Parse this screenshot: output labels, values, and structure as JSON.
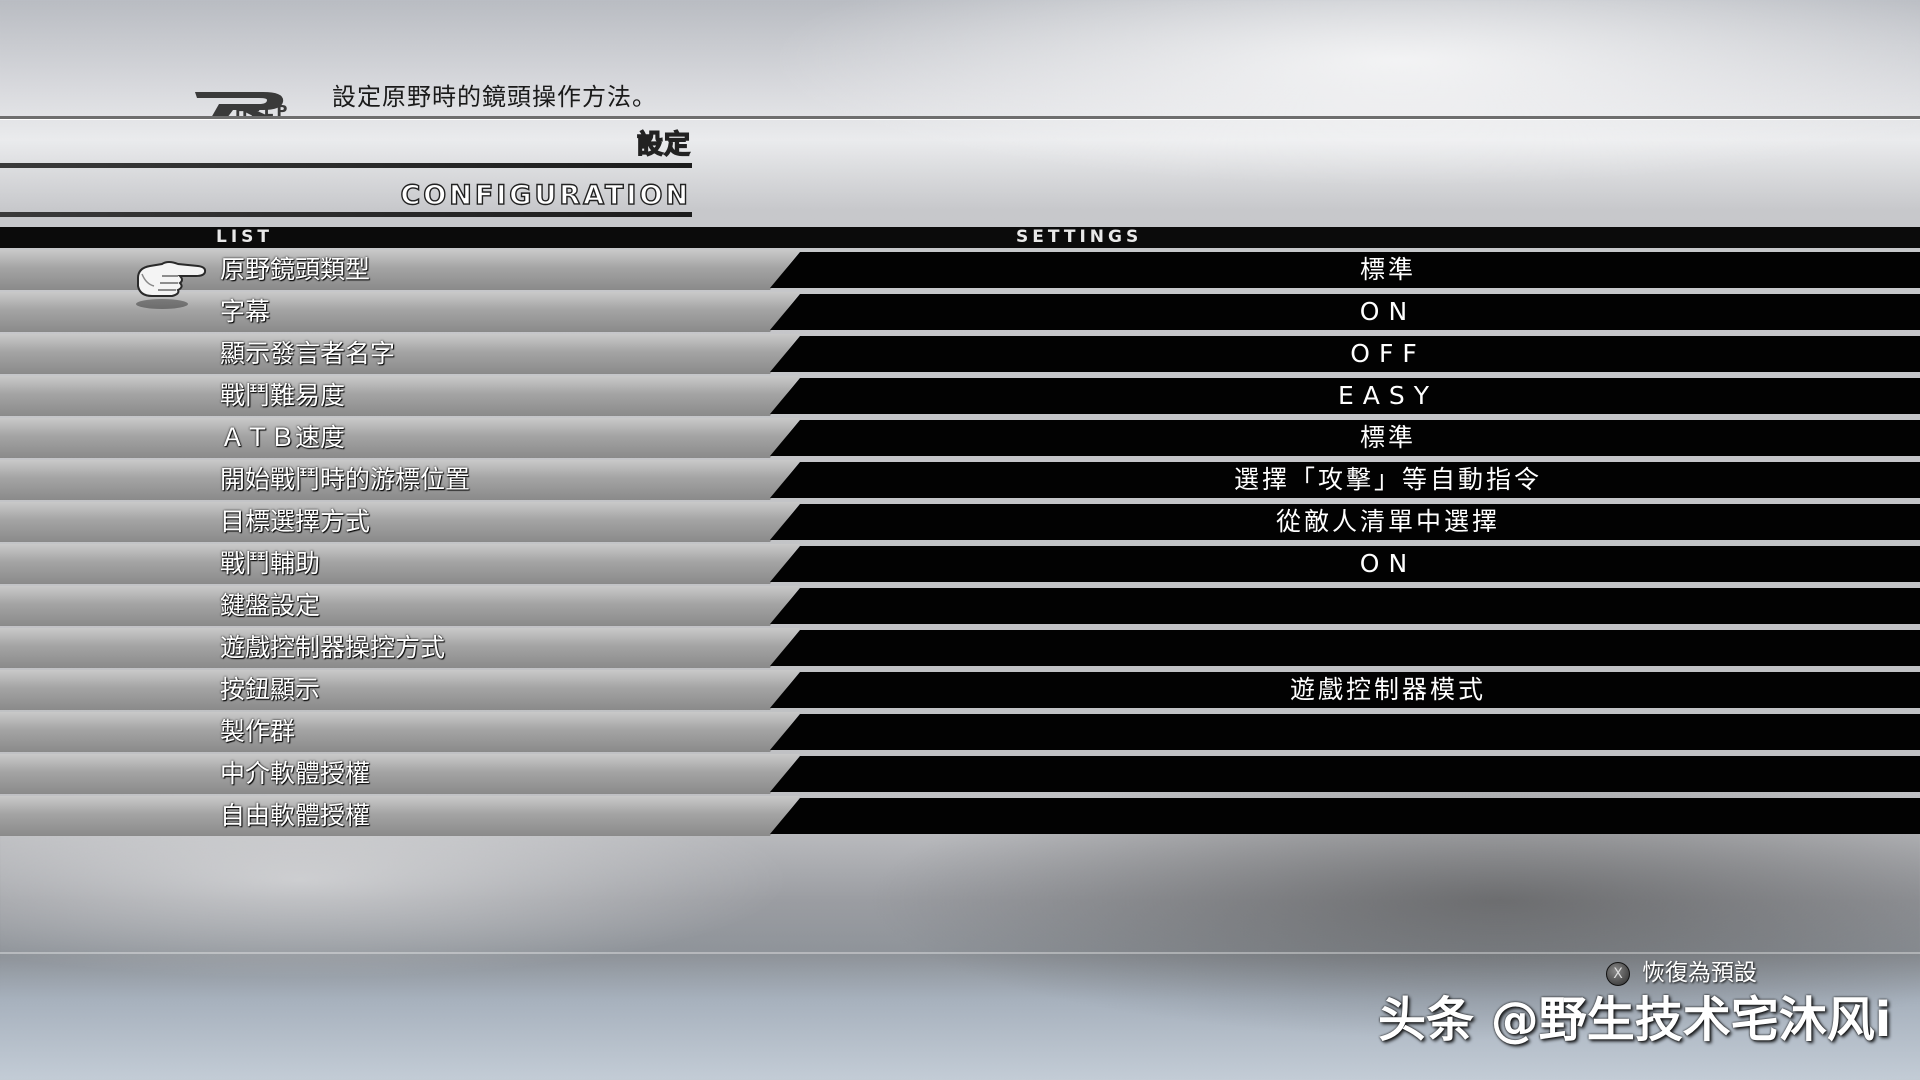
{
  "help": {
    "logo_text": "HELP",
    "text": "設定原野時的鏡頭操作方法。"
  },
  "title": {
    "jp": "設定",
    "en": "CONFIGURATION"
  },
  "header": {
    "list": "LIST",
    "settings": "SETTINGS"
  },
  "rows": [
    {
      "label": "原野鏡頭類型",
      "value": "標準"
    },
    {
      "label": "字幕",
      "value": "ON"
    },
    {
      "label": "顯示發言者名字",
      "value": "OFF"
    },
    {
      "label": "戰鬥難易度",
      "value": "EASY"
    },
    {
      "label": "ＡＴＢ速度",
      "value": "標準"
    },
    {
      "label": "開始戰鬥時的游標位置",
      "value": "選擇「攻擊」等自動指令"
    },
    {
      "label": "目標選擇方式",
      "value": "從敵人清單中選擇"
    },
    {
      "label": "戰鬥輔助",
      "value": "ON"
    },
    {
      "label": "鍵盤設定",
      "value": ""
    },
    {
      "label": "遊戲控制器操控方式",
      "value": ""
    },
    {
      "label": "按鈕顯示",
      "value": "遊戲控制器模式"
    },
    {
      "label": "製作群",
      "value": ""
    },
    {
      "label": "中介軟體授權",
      "value": ""
    },
    {
      "label": "自由軟體授權",
      "value": ""
    }
  ],
  "selected_index": 0,
  "footer": {
    "restore_button_glyph": "X",
    "restore_label": "恢復為預設"
  },
  "watermark": "头条 @野生技术宅沐风i",
  "icons": {
    "cursor": "pointing-hand-icon",
    "restore_button": "x-button-icon"
  }
}
